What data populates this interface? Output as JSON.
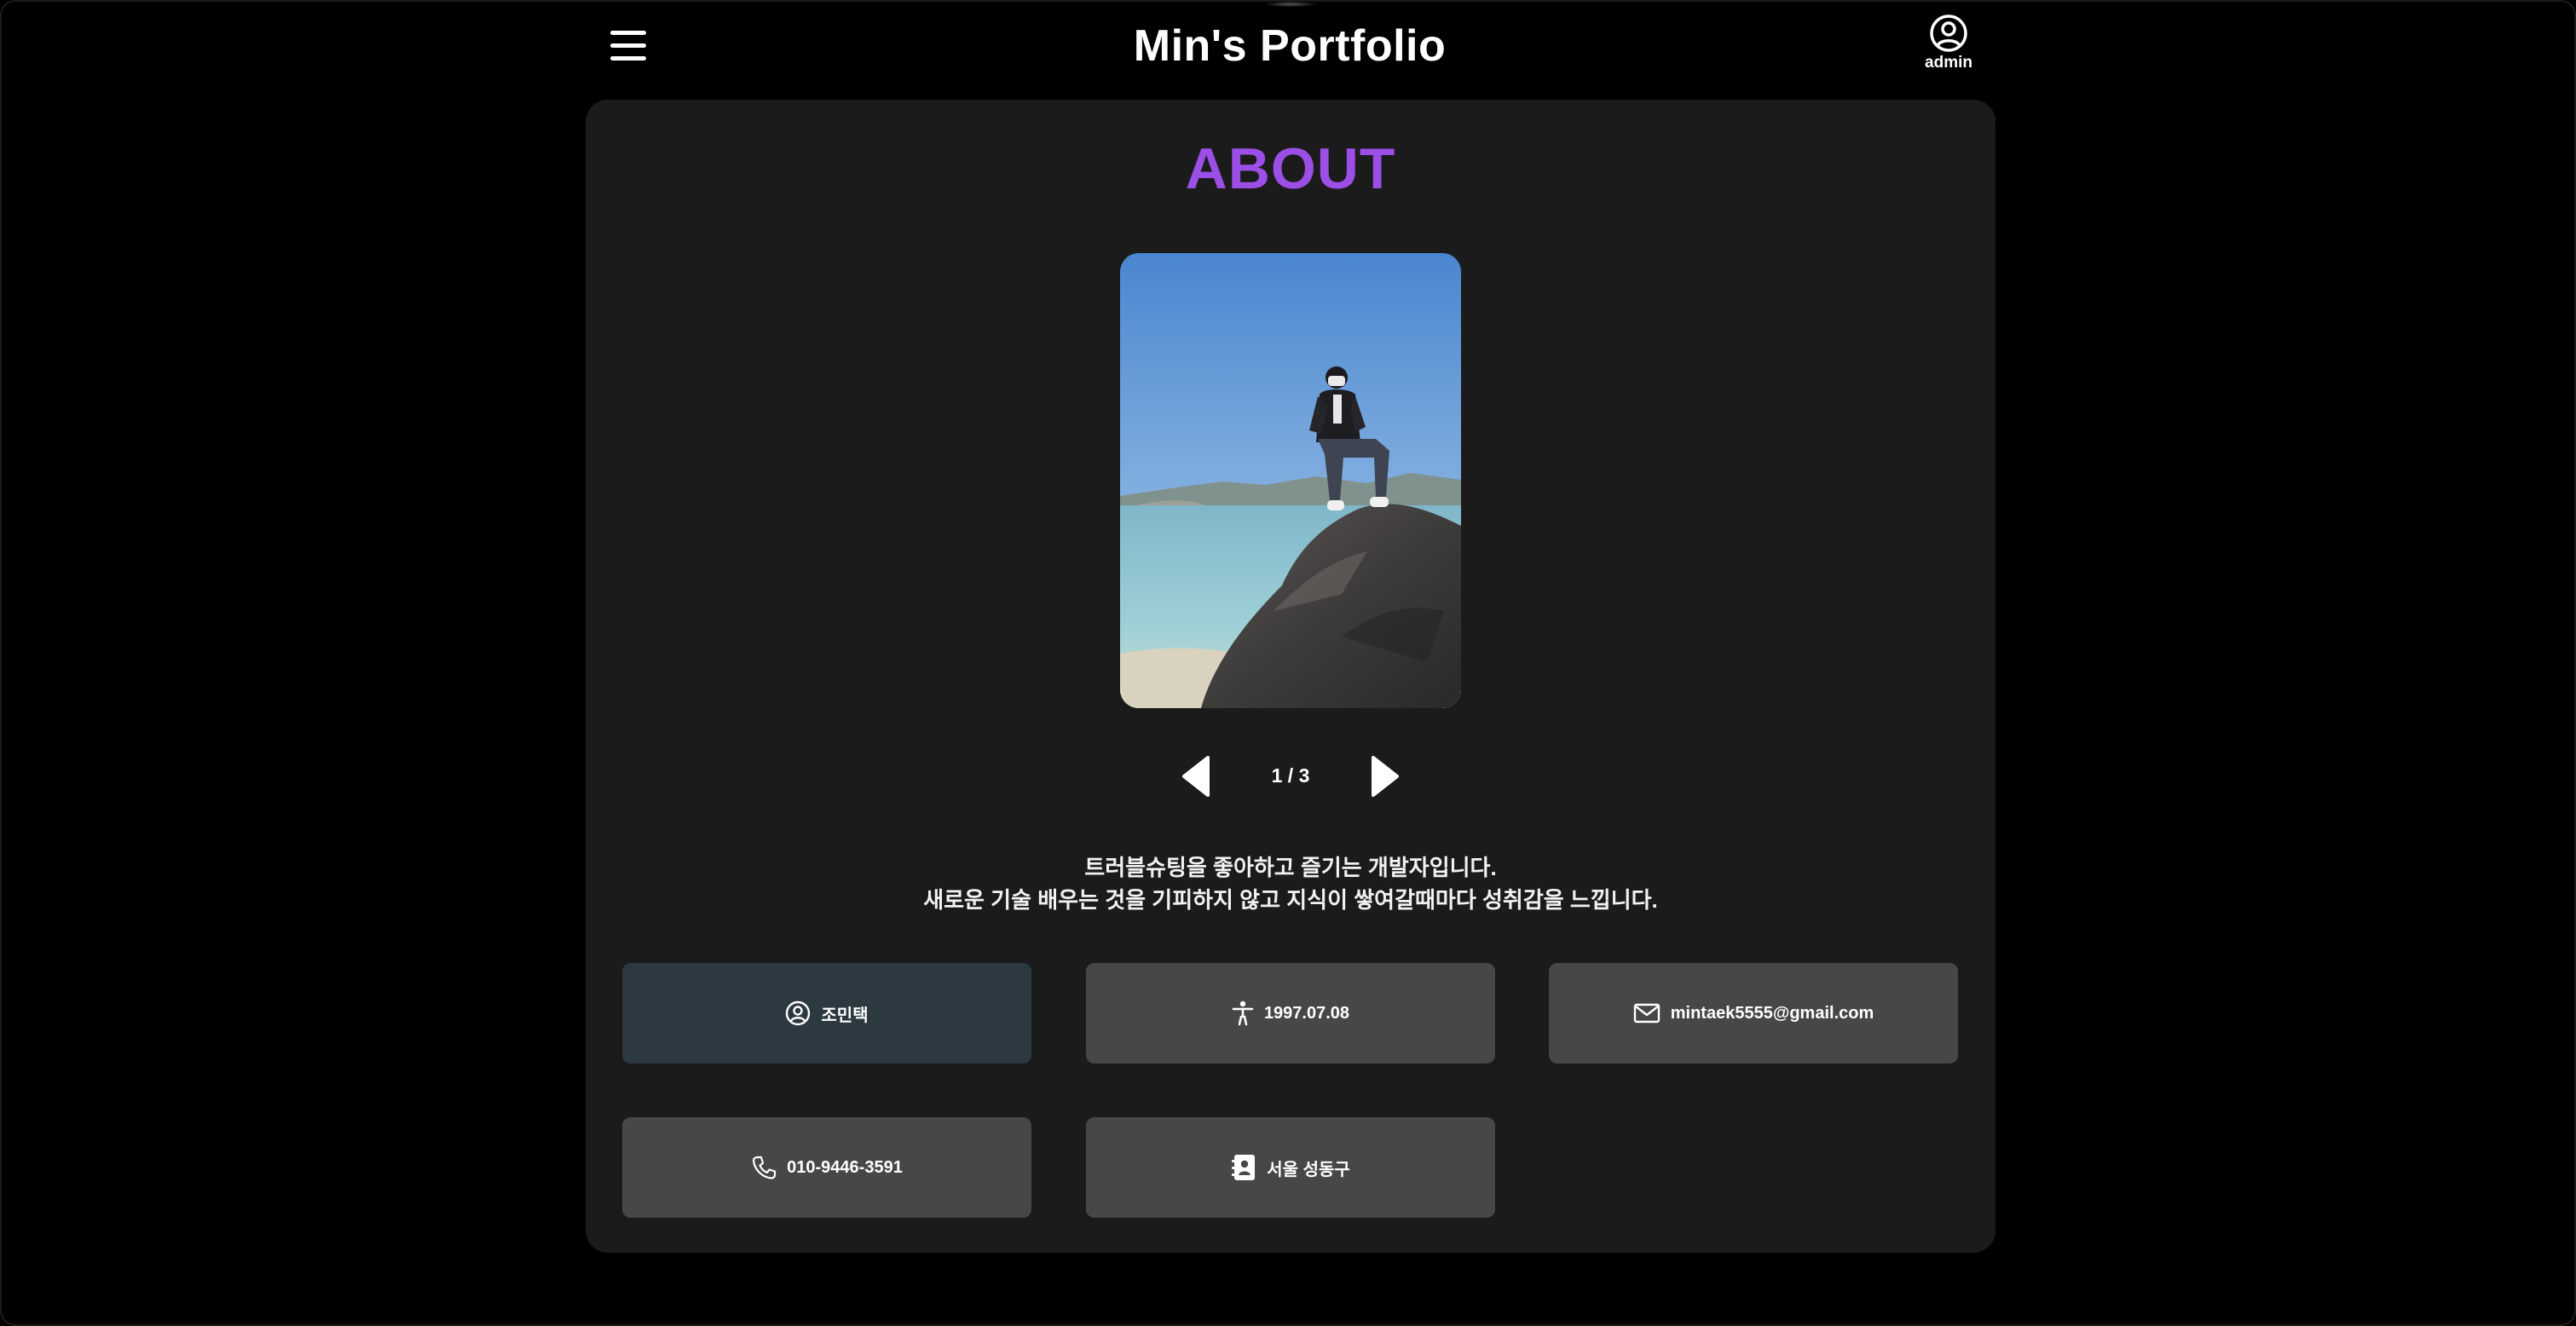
{
  "header": {
    "title": "Min's Portfolio",
    "menu_icon": "hamburger-menu-icon",
    "account_icon": "user-circle-icon",
    "account_label": "admin"
  },
  "about": {
    "title": "ABOUT",
    "title_color": "#9b4fe6",
    "photo": {
      "description_icon": "profile-photo",
      "carousel": {
        "current": 1,
        "total": 3,
        "indicator": "1 / 3",
        "prev_icon": "triangle-left-icon",
        "next_icon": "triangle-right-icon"
      }
    },
    "intro_lines": [
      "트러블슈팅을 좋아하고 즐기는 개발자입니다.",
      "새로운 기술 배우는 것을 기피하지 않고 지식이 쌓여갈때마다 성취감을 느낍니다."
    ],
    "info_items": [
      {
        "icon": "user-circle-icon",
        "label": "조민택",
        "active": true
      },
      {
        "icon": "person-standing-icon",
        "label": "1997.07.08",
        "active": false
      },
      {
        "icon": "mail-icon",
        "label": "mintaek5555@gmail.com",
        "active": false
      },
      {
        "icon": "phone-icon",
        "label": "010-9446-3591",
        "active": false
      },
      {
        "icon": "contact-book-icon",
        "label": "서울 성동구",
        "active": false
      }
    ]
  },
  "colors": {
    "page_background": "#000000",
    "card_background": "#1b1b1b",
    "tile_background": "#474747",
    "tile_active_background": "#2d3941",
    "accent": "#9b4fe6"
  }
}
